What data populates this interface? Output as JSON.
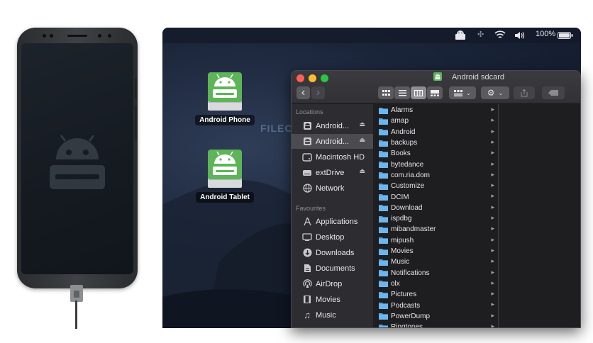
{
  "colors": {
    "accent_green": "#5db558",
    "folder_blue": "#4fa3e3",
    "traffic_red": "#ff5f57",
    "traffic_yellow": "#ffbd2e",
    "traffic_green": "#28c840"
  },
  "menubar": {
    "battery_text": "100%",
    "icons": [
      "android-drive-icon",
      "plus-cross-icon",
      "wifi-icon",
      "volume-icon",
      "battery-icon"
    ]
  },
  "desktop": {
    "icons": [
      {
        "label": "Android Phone",
        "icon": "android-drive-icon"
      },
      {
        "label": "Android Tablet",
        "icon": "android-drive-icon"
      }
    ],
    "watermark": "FILECR"
  },
  "finder": {
    "title": "Android sdcard",
    "toolbar": {
      "back": "‹",
      "forward": "›",
      "view_icons": [
        "icon-view-icon",
        "list-view-icon",
        "column-view-icon",
        "gallery-view-icon"
      ],
      "group_icon": "group-icon",
      "action_icon": "gear-icon",
      "share_icon": "share-icon",
      "tag_icon": "tag-icon"
    },
    "sidebar": {
      "locations_header": "Locations",
      "locations": [
        {
          "label": "Android...",
          "icon": "android-drive-icon",
          "eject": true
        },
        {
          "label": "Android...",
          "icon": "android-drive-icon",
          "eject": true,
          "selected": true
        },
        {
          "label": "Macintosh HD",
          "icon": "hard-drive-icon",
          "eject": false
        },
        {
          "label": "extDrive",
          "icon": "external-drive-icon",
          "eject": true
        },
        {
          "label": "Network",
          "icon": "globe-icon",
          "eject": false
        }
      ],
      "favourites_header": "Favourites",
      "favourites": [
        {
          "label": "Applications",
          "icon": "applications-icon"
        },
        {
          "label": "Desktop",
          "icon": "desktop-icon"
        },
        {
          "label": "Downloads",
          "icon": "download-icon"
        },
        {
          "label": "Documents",
          "icon": "document-icon"
        },
        {
          "label": "AirDrop",
          "icon": "airdrop-icon"
        },
        {
          "label": "Movies",
          "icon": "film-icon"
        },
        {
          "label": "Music",
          "icon": "music-icon"
        }
      ]
    },
    "folders": [
      "Alarms",
      "amap",
      "Android",
      "backups",
      "Books",
      "bytedance",
      "com.ria.dom",
      "Customize",
      "DCIM",
      "Download",
      "ispdbg",
      "mibandmaster",
      "mipush",
      "Movies",
      "Music",
      "Notifications",
      "olx",
      "Pictures",
      "Podcasts",
      "PowerDump",
      "Ringtones"
    ]
  }
}
